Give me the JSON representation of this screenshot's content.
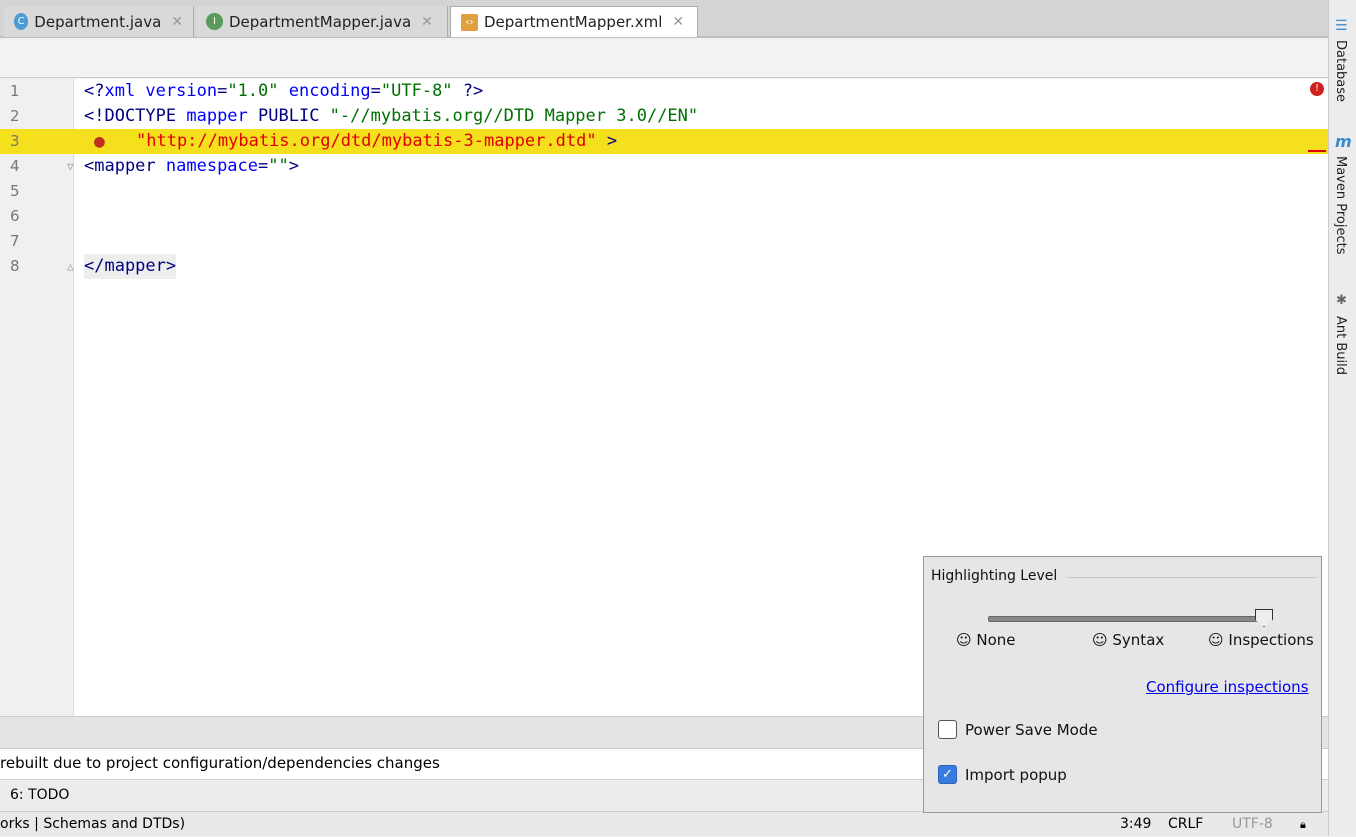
{
  "tabs": [
    {
      "label": "Department.java",
      "icon": "class-icon",
      "letter": "C",
      "color": "#4a9ad4"
    },
    {
      "label": "DepartmentMapper.java",
      "icon": "interface-icon",
      "letter": "I",
      "color": "#5a9a5a"
    },
    {
      "label": "DepartmentMapper.xml",
      "icon": "xml-file-icon",
      "active": true
    }
  ],
  "editor": {
    "lines": [
      "1",
      "2",
      "3",
      "4",
      "5",
      "6",
      "7",
      "8"
    ],
    "highlight_line": 3,
    "l1": {
      "a": "<?",
      "b": "xml version",
      "c": "=",
      "d": "\"1.0\"",
      "e": " encoding",
      "f": "=",
      "g": "\"UTF-8\"",
      "h": " ?>"
    },
    "l2": {
      "a": "<!DOCTYPE ",
      "b": "mapper",
      "c": " PUBLIC ",
      "d": "\"-//mybatis.org//DTD Mapper 3.0//EN\""
    },
    "l3": {
      "a": "\"http://mybatis.org/dtd/mybatis-3-mapper.dtd\"",
      "b": " >"
    },
    "l4": {
      "a": "<mapper ",
      "b": "namespace",
      "c": "=",
      "d": "\"\"",
      "e": ">"
    },
    "l8": {
      "a": "</mapper>"
    }
  },
  "right_tools": [
    "Database",
    "Maven Projects",
    "Ant Build"
  ],
  "message": "rebuilt due to project configuration/dependencies changes",
  "tool_window": {
    "todo": "6: TODO"
  },
  "status": {
    "left": "orks | Schemas and DTDs)",
    "position": "3:49",
    "line_sep": "CRLF",
    "encoding": "UTF-8"
  },
  "popup": {
    "title": "Highlighting Level",
    "levels": [
      "None",
      "Syntax",
      "Inspections"
    ],
    "selected": "Inspections",
    "configure_link": "Configure inspections",
    "power_save": {
      "label": "Power Save Mode",
      "checked": false
    },
    "import_popup": {
      "label": "Import popup",
      "checked": true
    }
  },
  "colors": {
    "highlight": "#f5e01e",
    "link": "#0000ee",
    "error": "#e00000"
  }
}
